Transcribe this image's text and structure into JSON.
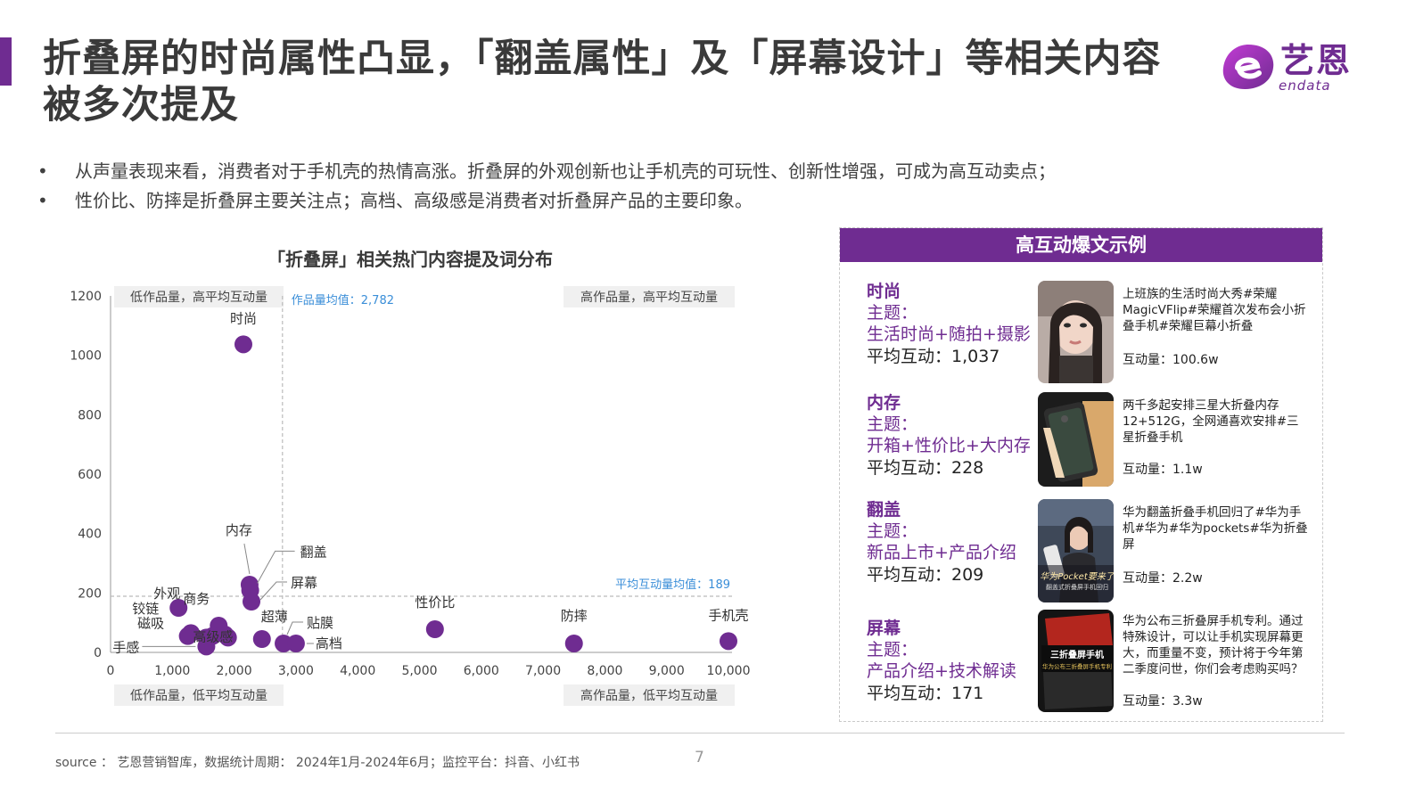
{
  "header": {
    "title": "折叠屏的时尚属性凸显，「翻盖属性」及「屏幕设计」等相关内容被多次提及",
    "logo_cn": "艺恩",
    "logo_en": "endata"
  },
  "bullets": [
    "从声量表现来看，消费者对于手机壳的热情高涨。折叠屏的外观创新也让手机壳的可玩性、创新性增强，可成为高互动卖点；",
    "性价比、防摔是折叠屏主要关注点；高档、高级感是消费者对折叠屏产品的主要印象。"
  ],
  "chart_data": {
    "type": "scatter",
    "title": "「折叠屏」相关热门内容提及词分布",
    "xlim": [
      0,
      10000
    ],
    "ylim": [
      0,
      1200
    ],
    "x_ticks": [
      "0",
      "1,000",
      "2,000",
      "3,000",
      "4,000",
      "5,000",
      "6,000",
      "7,000",
      "8,000",
      "9,000",
      "10,000"
    ],
    "y_ticks": [
      "0",
      "200",
      "400",
      "600",
      "800",
      "1000",
      "1200"
    ],
    "x_avg": 2782,
    "x_avg_label": "作品量均值：2,782",
    "y_avg": 189,
    "y_avg_label": "平均互动量均值：189",
    "quadrants": {
      "top_left": "低作品量，高平均互动量",
      "top_right": "高作品量，高平均互动量",
      "bottom_left": "低作品量，低平均互动量",
      "bottom_right": "高作品量，低平均互动量"
    },
    "points": [
      {
        "label": "时尚",
        "x": 2150,
        "y": 1037
      },
      {
        "label": "内存",
        "x": 2250,
        "y": 228
      },
      {
        "label": "翻盖",
        "x": 2260,
        "y": 209
      },
      {
        "label": "屏幕",
        "x": 2280,
        "y": 171
      },
      {
        "label": "外观",
        "x": 1850,
        "y": 60
      },
      {
        "label": "商务",
        "x": 1750,
        "y": 90
      },
      {
        "label": "铰链",
        "x": 1100,
        "y": 150
      },
      {
        "label": "高级感",
        "x": 1650,
        "y": 55
      },
      {
        "label": "磁吸",
        "x": 1300,
        "y": 65
      },
      {
        "label": "手感",
        "x": 1550,
        "y": 20
      },
      {
        "label": "超薄",
        "x": 2450,
        "y": 45
      },
      {
        "label": "贴膜",
        "x": 2800,
        "y": 30
      },
      {
        "label": "高档",
        "x": 3000,
        "y": 30
      },
      {
        "label": "性价比",
        "x": 5250,
        "y": 78
      },
      {
        "label": "防摔",
        "x": 7500,
        "y": 30
      },
      {
        "label": "手机壳",
        "x": 10000,
        "y": 38
      }
    ],
    "extra_points": [
      {
        "x": 1250,
        "y": 55
      },
      {
        "x": 1550,
        "y": 50
      },
      {
        "x": 1900,
        "y": 50
      }
    ],
    "point_color": "#6f2c91"
  },
  "panel": {
    "header": "高互动爆文示例",
    "items": [
      {
        "name": "时尚",
        "topic_label": "主题：",
        "topic": "生活时尚+随拍+摄影",
        "avg": "平均互动：1,037",
        "post": "上班族的生活时尚大秀#荣耀MagicVFlip#荣耀首次发布会小折叠手机#荣耀巨幕小折叠",
        "interaction": "互动量：100.6w"
      },
      {
        "name": "内存",
        "topic_label": "主题：",
        "topic": "开箱+性价比+大内存",
        "avg": "平均互动：228",
        "post": "两千多起安排三星大折叠内存12+512G，全网通喜欢安排#三星折叠手机",
        "interaction": "互动量：1.1w"
      },
      {
        "name": "翻盖",
        "topic_label": "主题：",
        "topic": "新品上市+产品介绍",
        "avg": "平均互动：209",
        "post": "华为翻盖折叠手机回归了#华为手机#华为#华为pockets#华为折叠屏",
        "interaction": "互动量：2.2w",
        "thumb_caption": "华为Pocket要来了",
        "thumb_sub": "翻盖式折叠屏手机回归"
      },
      {
        "name": "屏幕",
        "topic_label": "主题：",
        "topic": "产品介绍+技术解读",
        "avg": "平均互动：171",
        "post": "华为公布三折叠屏手机专利。通过特殊设计，可以让手机实现屏幕更大，而重量不变，预计将于今年第二季度问世，你们会考虑购买吗？",
        "interaction": "互动量：3.3w",
        "thumb_caption": "三折叠屏手机",
        "thumb_sub": "华为公布三折叠屏手机专利"
      }
    ]
  },
  "footer": {
    "source": "source ：  艺恩营销智库，数据统计周期：  2024年1月-2024年6月；监控平台：抖音、小红书",
    "page": "7"
  }
}
